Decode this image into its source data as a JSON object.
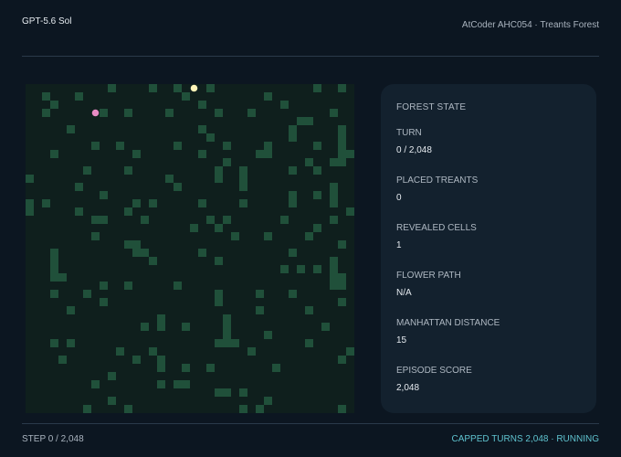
{
  "header": {
    "model": "GPT-5.6 Sol",
    "contest": "AtCoder AHC054 · Treants Forest"
  },
  "panel": {
    "title": "FOREST STATE",
    "stats": [
      {
        "label": "TURN",
        "value": "0 / 2,048"
      },
      {
        "label": "PLACED TREANTS",
        "value": "0"
      },
      {
        "label": "REVEALED CELLS",
        "value": "1"
      },
      {
        "label": "FLOWER PATH",
        "value": "N/A"
      },
      {
        "label": "MANHATTAN DISTANCE",
        "value": "15"
      },
      {
        "label": "EPISODE SCORE",
        "value": "2,048"
      }
    ]
  },
  "footer": {
    "step": "STEP 0 / 2,048",
    "status": "CAPPED TURNS 2,048 · RUNNING"
  },
  "board": {
    "size": 40,
    "colors": {
      "empty": "#0f1f1d",
      "tree": "#20503a",
      "player": "#fff4b8",
      "flower": "#e88bc4"
    },
    "player": [
      0,
      20
    ],
    "flower": [
      3,
      8
    ],
    "trees": [
      [
        0,
        10
      ],
      [
        0,
        15
      ],
      [
        0,
        18
      ],
      [
        0,
        22
      ],
      [
        0,
        35
      ],
      [
        0,
        38
      ],
      [
        1,
        2
      ],
      [
        1,
        6
      ],
      [
        1,
        19
      ],
      [
        1,
        29
      ],
      [
        2,
        3
      ],
      [
        2,
        21
      ],
      [
        2,
        31
      ],
      [
        3,
        2
      ],
      [
        3,
        9
      ],
      [
        3,
        12
      ],
      [
        3,
        17
      ],
      [
        3,
        23
      ],
      [
        3,
        27
      ],
      [
        3,
        37
      ],
      [
        4,
        33
      ],
      [
        4,
        34
      ],
      [
        5,
        5
      ],
      [
        5,
        21
      ],
      [
        5,
        32
      ],
      [
        5,
        38
      ],
      [
        6,
        22
      ],
      [
        6,
        32
      ],
      [
        6,
        38
      ],
      [
        7,
        8
      ],
      [
        7,
        11
      ],
      [
        7,
        18
      ],
      [
        7,
        24
      ],
      [
        7,
        29
      ],
      [
        7,
        35
      ],
      [
        7,
        38
      ],
      [
        8,
        3
      ],
      [
        8,
        13
      ],
      [
        8,
        21
      ],
      [
        8,
        28
      ],
      [
        8,
        29
      ],
      [
        8,
        38
      ],
      [
        8,
        39
      ],
      [
        9,
        24
      ],
      [
        9,
        34
      ],
      [
        9,
        37
      ],
      [
        9,
        38
      ],
      [
        10,
        7
      ],
      [
        10,
        12
      ],
      [
        10,
        23
      ],
      [
        10,
        26
      ],
      [
        10,
        32
      ],
      [
        10,
        35
      ],
      [
        11,
        0
      ],
      [
        11,
        17
      ],
      [
        11,
        23
      ],
      [
        11,
        26
      ],
      [
        12,
        6
      ],
      [
        12,
        18
      ],
      [
        12,
        26
      ],
      [
        12,
        37
      ],
      [
        13,
        9
      ],
      [
        13,
        32
      ],
      [
        13,
        35
      ],
      [
        13,
        37
      ],
      [
        14,
        0
      ],
      [
        14,
        2
      ],
      [
        14,
        13
      ],
      [
        14,
        15
      ],
      [
        14,
        21
      ],
      [
        14,
        26
      ],
      [
        14,
        32
      ],
      [
        14,
        37
      ],
      [
        15,
        0
      ],
      [
        15,
        6
      ],
      [
        15,
        12
      ],
      [
        15,
        39
      ],
      [
        16,
        8
      ],
      [
        16,
        9
      ],
      [
        16,
        14
      ],
      [
        16,
        22
      ],
      [
        16,
        24
      ],
      [
        16,
        31
      ],
      [
        16,
        37
      ],
      [
        17,
        20
      ],
      [
        17,
        23
      ],
      [
        17,
        35
      ],
      [
        18,
        8
      ],
      [
        18,
        25
      ],
      [
        18,
        29
      ],
      [
        18,
        34
      ],
      [
        19,
        12
      ],
      [
        19,
        13
      ],
      [
        19,
        38
      ],
      [
        20,
        3
      ],
      [
        20,
        13
      ],
      [
        20,
        14
      ],
      [
        20,
        21
      ],
      [
        20,
        32
      ],
      [
        21,
        3
      ],
      [
        21,
        15
      ],
      [
        21,
        23
      ],
      [
        21,
        37
      ],
      [
        22,
        3
      ],
      [
        22,
        31
      ],
      [
        22,
        33
      ],
      [
        22,
        35
      ],
      [
        22,
        37
      ],
      [
        23,
        3
      ],
      [
        23,
        4
      ],
      [
        23,
        37
      ],
      [
        23,
        38
      ],
      [
        24,
        9
      ],
      [
        24,
        12
      ],
      [
        24,
        18
      ],
      [
        24,
        37
      ],
      [
        24,
        38
      ],
      [
        25,
        3
      ],
      [
        25,
        7
      ],
      [
        25,
        23
      ],
      [
        25,
        28
      ],
      [
        25,
        32
      ],
      [
        26,
        9
      ],
      [
        26,
        23
      ],
      [
        26,
        38
      ],
      [
        27,
        5
      ],
      [
        27,
        28
      ],
      [
        27,
        34
      ],
      [
        28,
        16
      ],
      [
        28,
        24
      ],
      [
        29,
        14
      ],
      [
        29,
        16
      ],
      [
        29,
        19
      ],
      [
        29,
        24
      ],
      [
        29,
        36
      ],
      [
        30,
        24
      ],
      [
        30,
        29
      ],
      [
        31,
        3
      ],
      [
        31,
        5
      ],
      [
        31,
        23
      ],
      [
        31,
        24
      ],
      [
        31,
        25
      ],
      [
        31,
        34
      ],
      [
        32,
        11
      ],
      [
        32,
        15
      ],
      [
        32,
        27
      ],
      [
        32,
        39
      ],
      [
        33,
        4
      ],
      [
        33,
        13
      ],
      [
        33,
        16
      ],
      [
        33,
        38
      ],
      [
        34,
        16
      ],
      [
        34,
        19
      ],
      [
        34,
        22
      ],
      [
        34,
        30
      ],
      [
        35,
        10
      ],
      [
        36,
        8
      ],
      [
        36,
        16
      ],
      [
        36,
        18
      ],
      [
        36,
        19
      ],
      [
        37,
        23
      ],
      [
        37,
        24
      ],
      [
        37,
        26
      ],
      [
        38,
        10
      ],
      [
        38,
        29
      ],
      [
        39,
        7
      ],
      [
        39,
        12
      ],
      [
        39,
        26
      ],
      [
        39,
        28
      ],
      [
        39,
        38
      ]
    ]
  }
}
